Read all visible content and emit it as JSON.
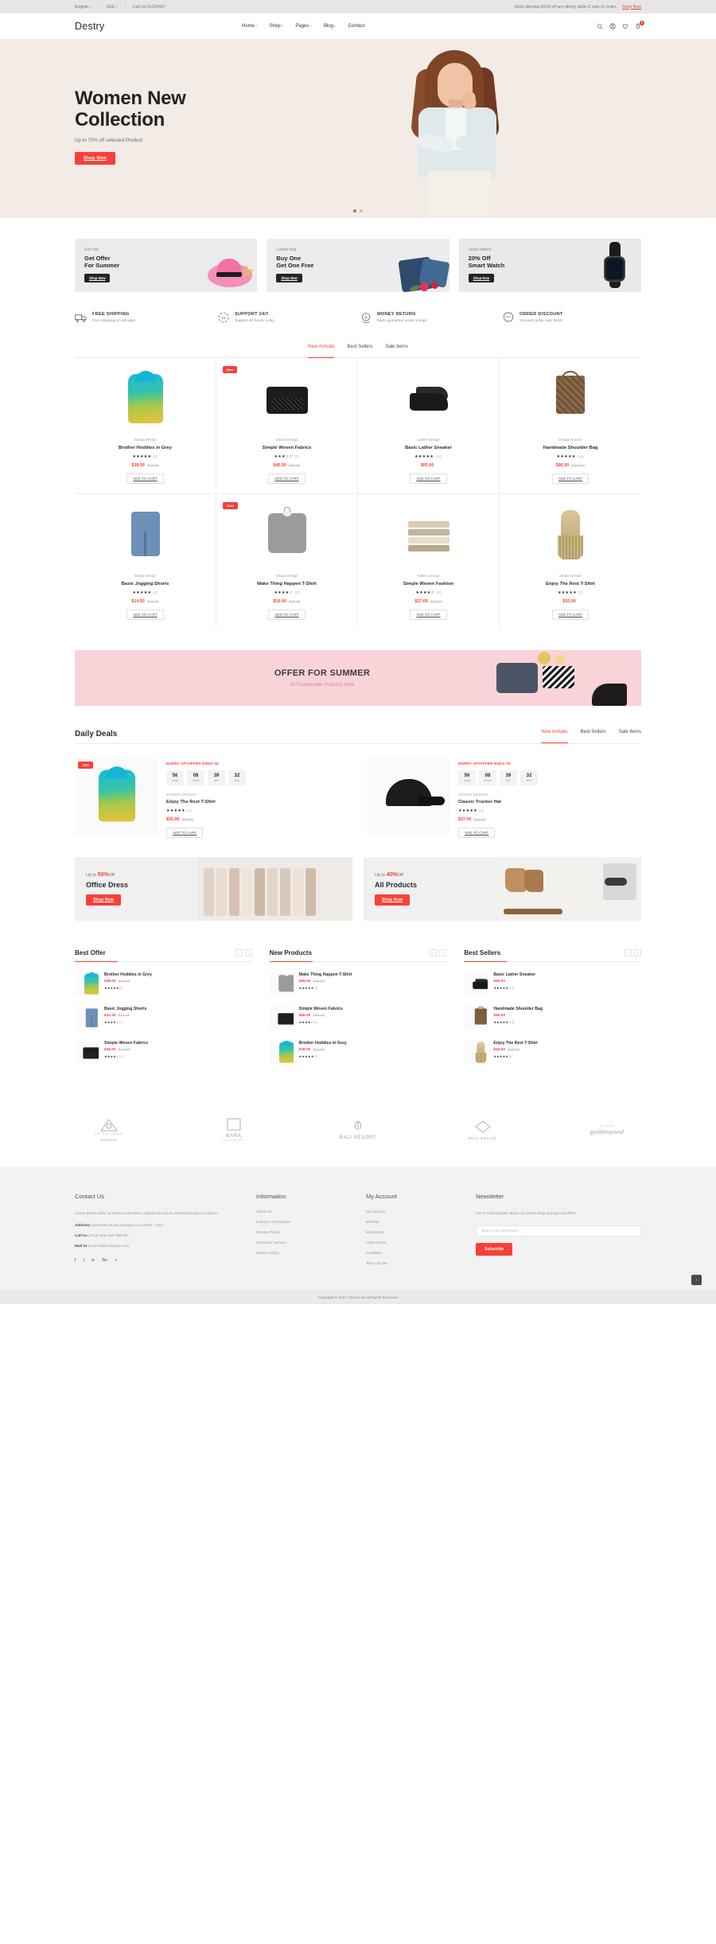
{
  "topbar": {
    "language": "English",
    "currency": "USD",
    "call": "Call Us 01234567",
    "promo": "Ends Monday:$100 off any dining table+2 sets of chairs.",
    "promo_link": "Shop Now"
  },
  "header": {
    "logo": "Destry",
    "nav": [
      {
        "label": "Home",
        "caret": "ˇ"
      },
      {
        "label": "Shop",
        "caret": "ˇ"
      },
      {
        "label": "Pages",
        "caret": "ˇ"
      },
      {
        "label": "Blog",
        "caret": "ˇ"
      },
      {
        "label": "Contact",
        "caret": ""
      }
    ],
    "cart_count": "0"
  },
  "hero": {
    "title_line1": "Women New",
    "title_line2": "Collection",
    "subtitle": "Up to 70% off selected Product",
    "button": "Shop Now"
  },
  "promos": [
    {
      "kicker": "Sun Hat",
      "title_1": "Get Offer",
      "title_2": "For Summer",
      "button": "Shop Now"
    },
    {
      "kicker": "Ladies Bag",
      "title_1": "Buy One",
      "title_2": "Get One Free",
      "button": "Shop Now"
    },
    {
      "kicker": "Smart Watch",
      "title_1": "20% Off",
      "title_2": "Smart Watch",
      "button": "Shop Now"
    }
  ],
  "features": [
    {
      "title": "FREE SHIPPING",
      "sub": "Free shipping on all order",
      "icon": "truck-icon"
    },
    {
      "title": "SUPPORT 24/7",
      "sub": "Support 24 hours a day",
      "icon": "clock-24-icon"
    },
    {
      "title": "MONEY RETURN",
      "sub": "Back guarantee under 5 days",
      "icon": "money-return-icon"
    },
    {
      "title": "ORDER DISCOUNT",
      "sub": "Onevery order over $150",
      "icon": "discount-badge-icon"
    }
  ],
  "product_tabs": [
    "New Arrivals",
    "Best Sellers",
    "Sale Items"
  ],
  "product_tab_active": "New Arrivals",
  "products": [
    {
      "tag": "",
      "vendor": "Studio Design",
      "name": "Brother Hoddies in Grey",
      "stars": 5,
      "count": "(4)",
      "price": "$38.50",
      "old": "$42.85",
      "cta": "ADD TO CART",
      "art": "hoodie"
    },
    {
      "tag": "New",
      "vendor": "Studio Design",
      "name": "Simple Woven Fabrics",
      "stars": 3,
      "count": "(2)",
      "price": "$45.50",
      "old": "$48.85",
      "cta": "ADD TO CART",
      "art": "fabric"
    },
    {
      "tag": "",
      "vendor": "Lather Design",
      "name": "Basic Lather Sneaker",
      "stars": 5,
      "count": "(12)",
      "price": "$65.00",
      "old": "",
      "cta": "ADD TO CART",
      "art": "shoe"
    },
    {
      "tag": "",
      "vendor": "Design Source",
      "name": "Handmade Shoulder Bag",
      "stars": 5,
      "count": "(18)",
      "price": "$96.50",
      "old": "$100.00",
      "cta": "ADD TO CART",
      "art": "bag"
    },
    {
      "tag": "",
      "vendor": "Studio Design",
      "name": "Basic Jogging Shorts",
      "stars": 5,
      "count": "(4)",
      "price": "$14.50",
      "old": "$18.00",
      "cta": "ADD TO CART",
      "art": "jeans"
    },
    {
      "tag": "Sold",
      "vendor": "Studio Design",
      "name": "Make Thing Happen T-Shirt",
      "stars": 4,
      "count": "(2)",
      "price": "$16.00",
      "old": "$18.00",
      "cta": "ADD TO CART",
      "art": "tshirt"
    },
    {
      "tag": "",
      "vendor": "Fabric Design",
      "name": "Simple Woven Fashion",
      "stars": 4,
      "count": "(6)",
      "price": "$27.00",
      "old": "$33.00",
      "cta": "ADD TO CART",
      "art": "stack"
    },
    {
      "tag": "",
      "vendor": "Studio Design",
      "name": "Enjoy The Rest T-Shirt",
      "stars": 5,
      "count": "(4)",
      "price": "$32.00",
      "old": "",
      "cta": "ADD TO CART",
      "art": "dress"
    }
  ],
  "summer_banner": {
    "title": "OFFER FOR SUMMER",
    "subtitle": "All Fashionable Products Here"
  },
  "daily_deals": {
    "title": "Daily Deals",
    "tabs": [
      "New Arrivals",
      "Best Sellers",
      "Sale Items"
    ],
    "tab_active": "New Arrivals",
    "items": [
      {
        "tag": "-25%",
        "hurry": "HURRY UP!OFFER ENDS IN:",
        "countdown": [
          {
            "num": "56",
            "label": "Days"
          },
          {
            "num": "08",
            "label": "Hours"
          },
          {
            "num": "39",
            "label": "Min"
          },
          {
            "num": "32",
            "label": "Sec"
          }
        ],
        "vendor": "STUDIO DESIGN",
        "name": "Enjoy The Rest T-Shirt",
        "stars": 5,
        "count": "(4)",
        "price": "$35.00",
        "old": "$40.00",
        "cta": "ADD TO CART",
        "art": "hoodie"
      },
      {
        "tag": "",
        "hurry": "HURRY UP!OFFER ENDS IN:",
        "countdown": [
          {
            "num": "56",
            "label": "Days"
          },
          {
            "num": "08",
            "label": "Hours"
          },
          {
            "num": "39",
            "label": "Min"
          },
          {
            "num": "32",
            "label": "Sec"
          }
        ],
        "vendor": "STUDIO DESIGN",
        "name": "Classic Trucker Hat",
        "stars": 5,
        "count": "(4)",
        "price": "$37.00",
        "old": "$40.00",
        "cta": "ADD TO CART",
        "art": "cap"
      }
    ]
  },
  "mid_banners": [
    {
      "kicker_pre": "Up to ",
      "kicker_b": "50%",
      "kicker_post": "Off",
      "title": "Office Dress",
      "button": "Shop Now"
    },
    {
      "kicker_pre": "Up to ",
      "kicker_b": "40%",
      "kicker_post": "Off",
      "title": "All Products",
      "button": "Shop Now"
    }
  ],
  "columns": [
    {
      "title": "Best Offer",
      "items": [
        {
          "name": "Brother Hoddies in Grey",
          "price": "$38.00",
          "old": "$40.00",
          "stars": 5,
          "count": "(4)",
          "art": "hoodie"
        },
        {
          "name": "Basic Jogging Shorts",
          "price": "$32.00",
          "old": "$37.00",
          "stars": 4,
          "count": "(4)",
          "art": "jeans"
        },
        {
          "name": "Simple Woven Fabrics",
          "price": "$36.00",
          "old": "$40.00",
          "stars": 4,
          "count": "(2)",
          "art": "fabric"
        }
      ]
    },
    {
      "title": "New Products",
      "items": [
        {
          "name": "Make Thing Happen T-Shirt",
          "price": "$68.00",
          "old": "$79.00",
          "stars": 5,
          "count": "(4)",
          "art": "tshirt"
        },
        {
          "name": "Simple Woven Fabrics",
          "price": "$66.00",
          "old": "$69.00",
          "stars": 4,
          "count": "(2)",
          "art": "fabric"
        },
        {
          "name": "Brother Hoddies in Grey",
          "price": "$39.00",
          "old": "$42.00",
          "stars": 5,
          "count": "(4)",
          "art": "hoodie"
        }
      ]
    },
    {
      "title": "Best Sellers",
      "items": [
        {
          "name": "Basic Lather Sneaker",
          "price": "$65.00",
          "old": "",
          "stars": 5,
          "count": "(12)",
          "art": "shoe"
        },
        {
          "name": "Handmade Shoulder Bag",
          "price": "$96.00",
          "old": "",
          "stars": 5,
          "count": "(18)",
          "art": "bag"
        },
        {
          "name": "Enjoy The Rest T-Shirt",
          "price": "$44.00",
          "old": "$49.00",
          "stars": 5,
          "count": "(6)",
          "art": "dress"
        }
      ]
    }
  ],
  "brands": [
    {
      "name": "SUNDAY",
      "sub": "ESTABLISHED"
    },
    {
      "name": "MARA",
      "sub": "CLOTHING"
    },
    {
      "name": "BALI RESORT",
      "sub": ""
    },
    {
      "name": "REAL ESTATE",
      "sub": ""
    },
    {
      "name": "goldenpond",
      "sub": "SILVER"
    }
  ],
  "footer": {
    "contact": {
      "title": "Contact Us",
      "text": "Lorem ipsum dolor sit amet,consectetur adipisicing sed do eiusmod tempor incididun",
      "address_label": "Address:",
      "address": "123 Main Street,Anytown,CA 12345 - USA",
      "call_label": "Call to:",
      "call": "(+012) 800 456 789-987",
      "mail_label": "Mail to:",
      "mail": "yourmail@example.com"
    },
    "information": {
      "title": "Information",
      "links": [
        "About Us",
        "Delivery Information",
        "Privacy Policy",
        "Customer Service",
        "Return Policy"
      ]
    },
    "account": {
      "title": "My Account",
      "links": [
        "My Account",
        "Wishlist",
        "Newsletter",
        "Help Center",
        "Condition",
        "Term Of Use"
      ]
    },
    "newsletter": {
      "title": "Newsletter",
      "text": "Get E-mail updates about our latest shop and special offers.",
      "placeholder": "Enter your email here.",
      "button": "Subscribe"
    }
  },
  "copyright": "Copyright © 2021 ThemeLab All Rights Reserved",
  "back_to_top": "↑",
  "colors": {
    "accent": "#f8403a",
    "hero_bg": "#f2ebe6",
    "summer_bg": "#f9d3d8",
    "footer_bg": "#f2f2f2"
  }
}
